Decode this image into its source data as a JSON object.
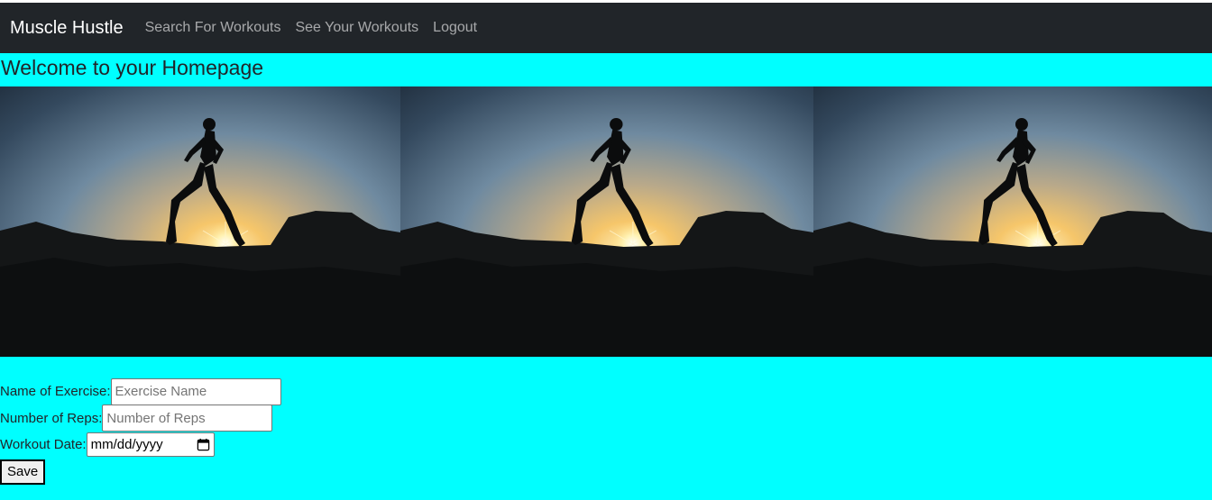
{
  "navbar": {
    "brand": "Muscle Hustle",
    "links": [
      "Search For Workouts",
      "See Your Workouts",
      "Logout"
    ],
    "background": "#212529"
  },
  "page": {
    "title": "Welcome to your Homepage",
    "background": "#00ffff"
  },
  "banner": {
    "photo_count": 3,
    "subject": "silhouette of woman running at sunset"
  },
  "form": {
    "exercise_label": "Name of Exercise:",
    "exercise_placeholder": "Exercise Name",
    "reps_label": "Number of Reps:",
    "reps_placeholder": "Number of Reps",
    "date_label": "Workout Date:",
    "date_value": "mm/dd/yyyy",
    "save_label": "Save"
  }
}
